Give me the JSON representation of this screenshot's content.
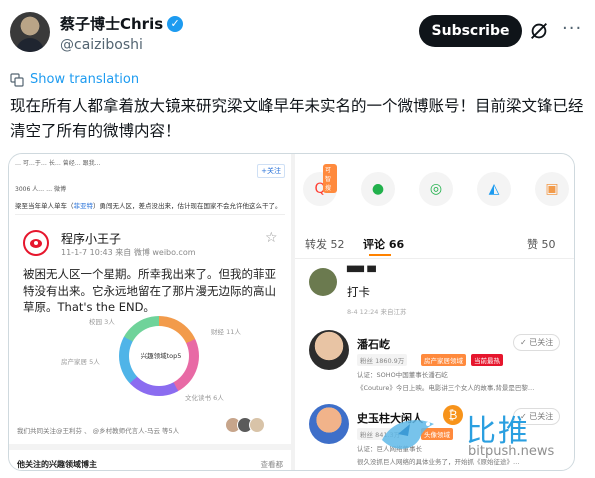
{
  "header": {
    "display_name": "蔡子博士Chris",
    "handle": "@caiziboshi",
    "subscribe_label": "Subscribe"
  },
  "post": {
    "show_translation": "Show translation",
    "text": "现在所有人都拿着放大镜来研究梁文峰早年未实名的一个微博账号！目前梁文锋已经清空了所有的微博内容！"
  },
  "left_shot": {
    "topline": "…  可…于… 长… 曾经…  跟我…",
    "follow": "+关注",
    "intro": "3006 人… … 微博",
    "topic_pre": "梁至当年单人单车（",
    "topic_link": "菲亚特",
    "topic_post": "）勇闯无人区，差点没出来，估计现在国家不会允许他这么干了。",
    "weibo_name": "程序小王子",
    "weibo_meta": "11-1-7 10:43  来自 微博 weibo.com",
    "weibo_body": "被困无人区一个星期。所幸我出来了。但我的菲亚特没有出来。它永远地留在了那片漫无边际的高山草原。That's the END。",
    "donut_center": "兴趣领域top5",
    "donut_labels": {
      "a": "校园 3人",
      "b": "财经 11人",
      "c": "房产家居 5人",
      "d": "文化读书 6人"
    },
    "common_follow": "我们共同关注@王利芬 、 @乡村教师代言人-马云 等5人",
    "interest_title": "他关注的兴趣领域博主",
    "view_more": "查看都"
  },
  "right_shot": {
    "hot_tag": "可智搜",
    "tabs": {
      "repost": "转发 52",
      "comments": "评论 66",
      "likes": "赞 50"
    },
    "c1_name": "▀▀ ▀",
    "c1_text": "打卡",
    "c1_faded": "8-4 12:24  来自江苏",
    "u1": {
      "name": "潘石屹",
      "fans": "粉丝 1860.9万",
      "badge1": "房产家居领域",
      "badge2": "当前最热",
      "info1": "认证：SOHO中国董事长潘石屹",
      "info2": "《Couture》今日上映。电影讲三个女人的故事,背景是巴黎…",
      "followed": "✓ 已关注"
    },
    "u2": {
      "name": "史玉柱大闲人",
      "fans": "粉丝 841.3万",
      "badge1": "头像领域",
      "info1": "认证：巨人网络董事长",
      "info2": "很久没抓巨人网络的具体业务了，开始抓《原始征途》…",
      "followed": "✓ 已关注"
    }
  },
  "watermark": {
    "cn": "比推",
    "url": "bitpush.news"
  }
}
